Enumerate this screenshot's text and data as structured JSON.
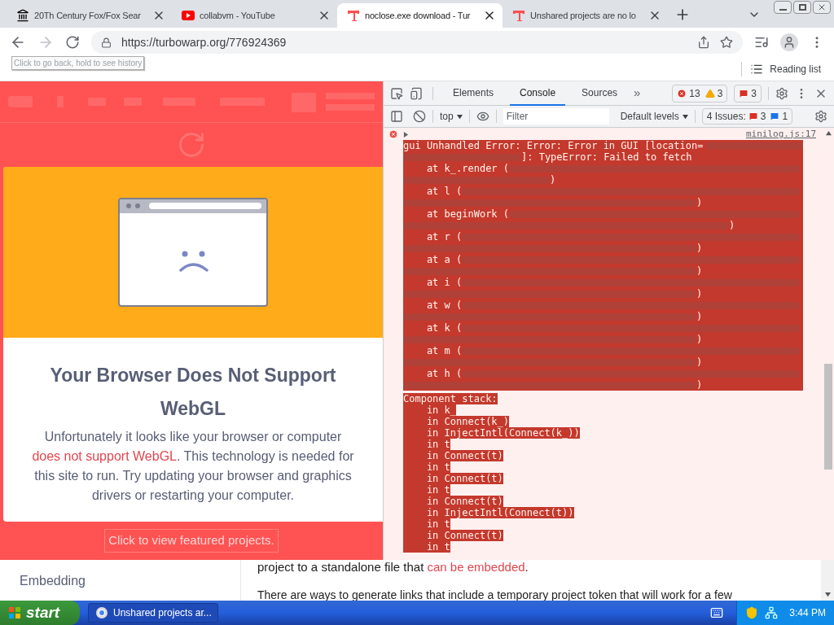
{
  "browser": {
    "tabs": [
      {
        "title": "20Th Century Fox/Fox Sear",
        "kind": "building",
        "selected": false
      },
      {
        "title": "collabvm - YouTube",
        "kind": "youtube",
        "selected": false
      },
      {
        "title": "noclose.exe download - Tur",
        "kind": "turbowarp",
        "selected": true
      },
      {
        "title": "Unshared projects are no lo",
        "kind": "turbowarp",
        "selected": false
      }
    ],
    "url": "https://turbowarp.org/776924369",
    "tooltip": "Click to go back, hold to see history",
    "reading_list": "Reading list"
  },
  "page": {
    "modal": {
      "heading": "Your Browser Does Not Support WebGL",
      "text_before": "Unfortunately it looks like your browser or computer ",
      "link": "does not support WebGL",
      "text_after": ". This technology is needed for this site to run. Try updating your browser and graphics drivers or restarting your computer."
    },
    "featured_button": "Click to view featured projects.",
    "sidebar_item": "Embedding",
    "paragraph_before": "project to a standalone file that ",
    "paragraph_link": "can be embedded",
    "paragraph_after": ".",
    "next_paragraph": "There are ways to generate links that include a temporary project token that will work for a few"
  },
  "devtools": {
    "tabs": [
      {
        "label": "Elements",
        "selected": false
      },
      {
        "label": "Console",
        "selected": true
      },
      {
        "label": "Sources",
        "selected": false
      }
    ],
    "more": "»",
    "error_count": "13",
    "warning_count": "3",
    "issue_badge": "3",
    "context": "top",
    "filter_placeholder": "Filter",
    "levels": "Default levels",
    "issues_label": "4 Issues:",
    "issue_errors": "3",
    "issue_info": "1",
    "console": {
      "source": "minilog.js:17",
      "head": [
        "gui Unhandled Error: Error: Error in GUI [location=",
        "]: TypeError: Failed to fetch"
      ],
      "frames": [
        {
          "call": "    at k_.render (",
          "close": ")"
        },
        {
          "call": "    at l (",
          "close": ")"
        },
        {
          "call": "    at beginWork (",
          "close": ")"
        },
        {
          "call": "    at r (",
          "close": ")"
        },
        {
          "call": "    at a (",
          "close": ")"
        },
        {
          "call": "    at i (",
          "close": ")"
        },
        {
          "call": "    at w (",
          "close": ")"
        },
        {
          "call": "    at k (",
          "close": ")"
        },
        {
          "call": "    at m (",
          "close": ")"
        },
        {
          "call": "    at h (",
          "close": ")"
        }
      ],
      "stack_title": "Component stack:",
      "stack": [
        "    in k_",
        "    in Connect(k_)",
        "    in InjectIntl(Connect(k_))",
        "    in t",
        "    in Connect(t)",
        "    in t",
        "    in Connect(t)",
        "    in t",
        "    in Connect(t)",
        "    in InjectIntl(Connect(t))",
        "    in t",
        "    in Connect(t)",
        "    in t"
      ]
    }
  },
  "taskbar": {
    "start": "start",
    "task": "Unshared projects ar...",
    "clock": "3:44 PM"
  }
}
